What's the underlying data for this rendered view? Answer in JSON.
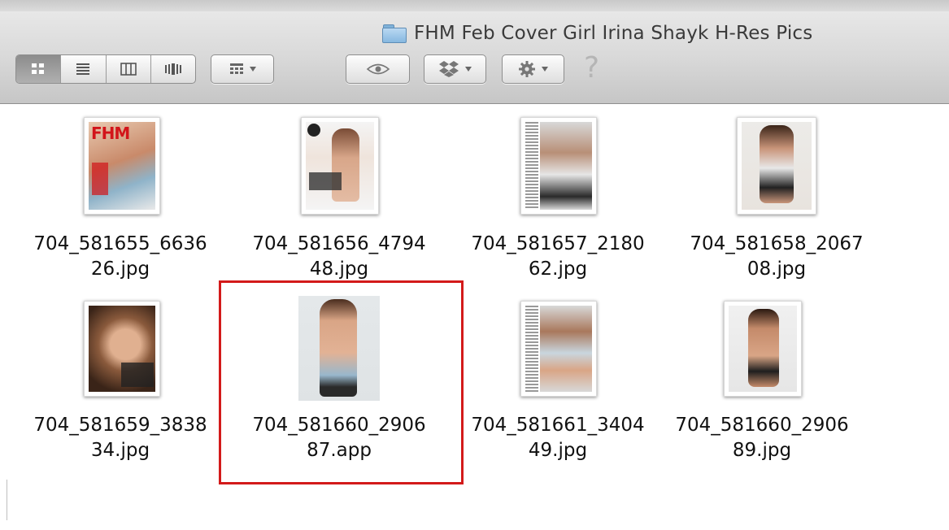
{
  "window": {
    "title": "FHM Feb Cover Girl Irina Shayk H-Res Pics",
    "title_icon": "folder-icon"
  },
  "toolbar": {
    "view_modes": [
      {
        "name": "icon-view",
        "icon": "grid-icon",
        "active": true
      },
      {
        "name": "list-view",
        "icon": "list-icon",
        "active": false
      },
      {
        "name": "column-view",
        "icon": "columns-icon",
        "active": false
      },
      {
        "name": "cover-flow-view",
        "icon": "coverflow-icon",
        "active": false
      }
    ],
    "arrange_icon": "arrange-grid-icon",
    "quick_look_icon": "eye-icon",
    "dropbox_icon": "dropbox-icon",
    "action_icon": "gear-icon",
    "help_glyph": "?"
  },
  "files": [
    {
      "line1": "704_581655_6636",
      "line2": "26.jpg"
    },
    {
      "line1": "704_581656_4794",
      "line2": "48.jpg"
    },
    {
      "line1": "704_581657_2180",
      "line2": "62.jpg"
    },
    {
      "line1": "704_581658_2067",
      "line2": "08.jpg"
    },
    {
      "line1": "704_581659_3838",
      "line2": "34.jpg"
    },
    {
      "line1": "704_581660_2906",
      "line2": "87.app",
      "highlighted": true
    },
    {
      "line1": "704_581661_3404",
      "line2": "49.jpg"
    },
    {
      "line1": "704_581660_2906",
      "line2": "89.jpg"
    }
  ],
  "colors": {
    "highlight_border": "#d31a1a",
    "toolbar_bg": "#d9d9d9"
  }
}
